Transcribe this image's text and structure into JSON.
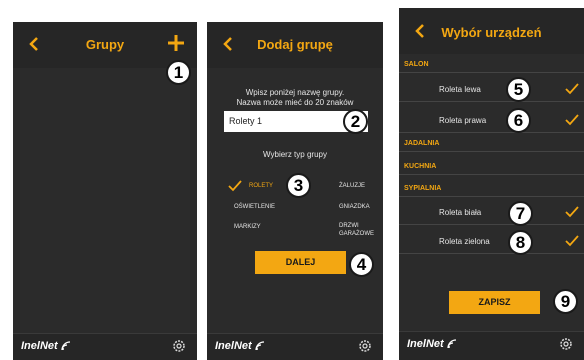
{
  "screen1": {
    "title": "Grupy",
    "logo": "InelNet",
    "badge": "1"
  },
  "screen2": {
    "title": "Dodaj grupę",
    "instruction_line1": "Wpisz poniżej nazwę grupy.",
    "instruction_line2": "Nazwa może mieć do 20 znaków",
    "name_value": "Rolety 1",
    "type_title": "Wybierz typ grupy",
    "types": {
      "rolety": "ROLETY",
      "zaluzje": "ŻALUZJE",
      "oswietlenie": "OŚWIETLENIE",
      "gniazdka": "GNIAZDKA",
      "markizy": "MARKIZY",
      "drzwi_line1": "DRZWI",
      "drzwi_line2": "GARAŻOWE"
    },
    "selected_type": "ROLETY",
    "next_button": "DALEJ",
    "logo": "InelNet",
    "badges": [
      "2",
      "3",
      "4"
    ]
  },
  "screen3": {
    "title": "Wybór urządzeń",
    "sections": {
      "salon": "SALON",
      "jadalnia": "JADALNIA",
      "kuchnia": "KUCHNIA",
      "sypialnia": "SYPIALNIA"
    },
    "devices": {
      "roleta_lewa": "Roleta lewa",
      "roleta_prawa": "Roleta prawa",
      "roleta_biala": "Roleta biała",
      "roleta_zielona": "Roleta zielona"
    },
    "save_button": "ZAPISZ",
    "logo": "InelNet",
    "badges": [
      "5",
      "6",
      "7",
      "8",
      "9"
    ]
  },
  "colors": {
    "accent": "#f3a712",
    "background": "#2b2b2b",
    "header": "#262626",
    "text": "#e6e6e6"
  },
  "icons": [
    "back-chevron-icon",
    "plus-icon",
    "gear-icon",
    "wifi-signal-icon",
    "checkmark-icon"
  ]
}
